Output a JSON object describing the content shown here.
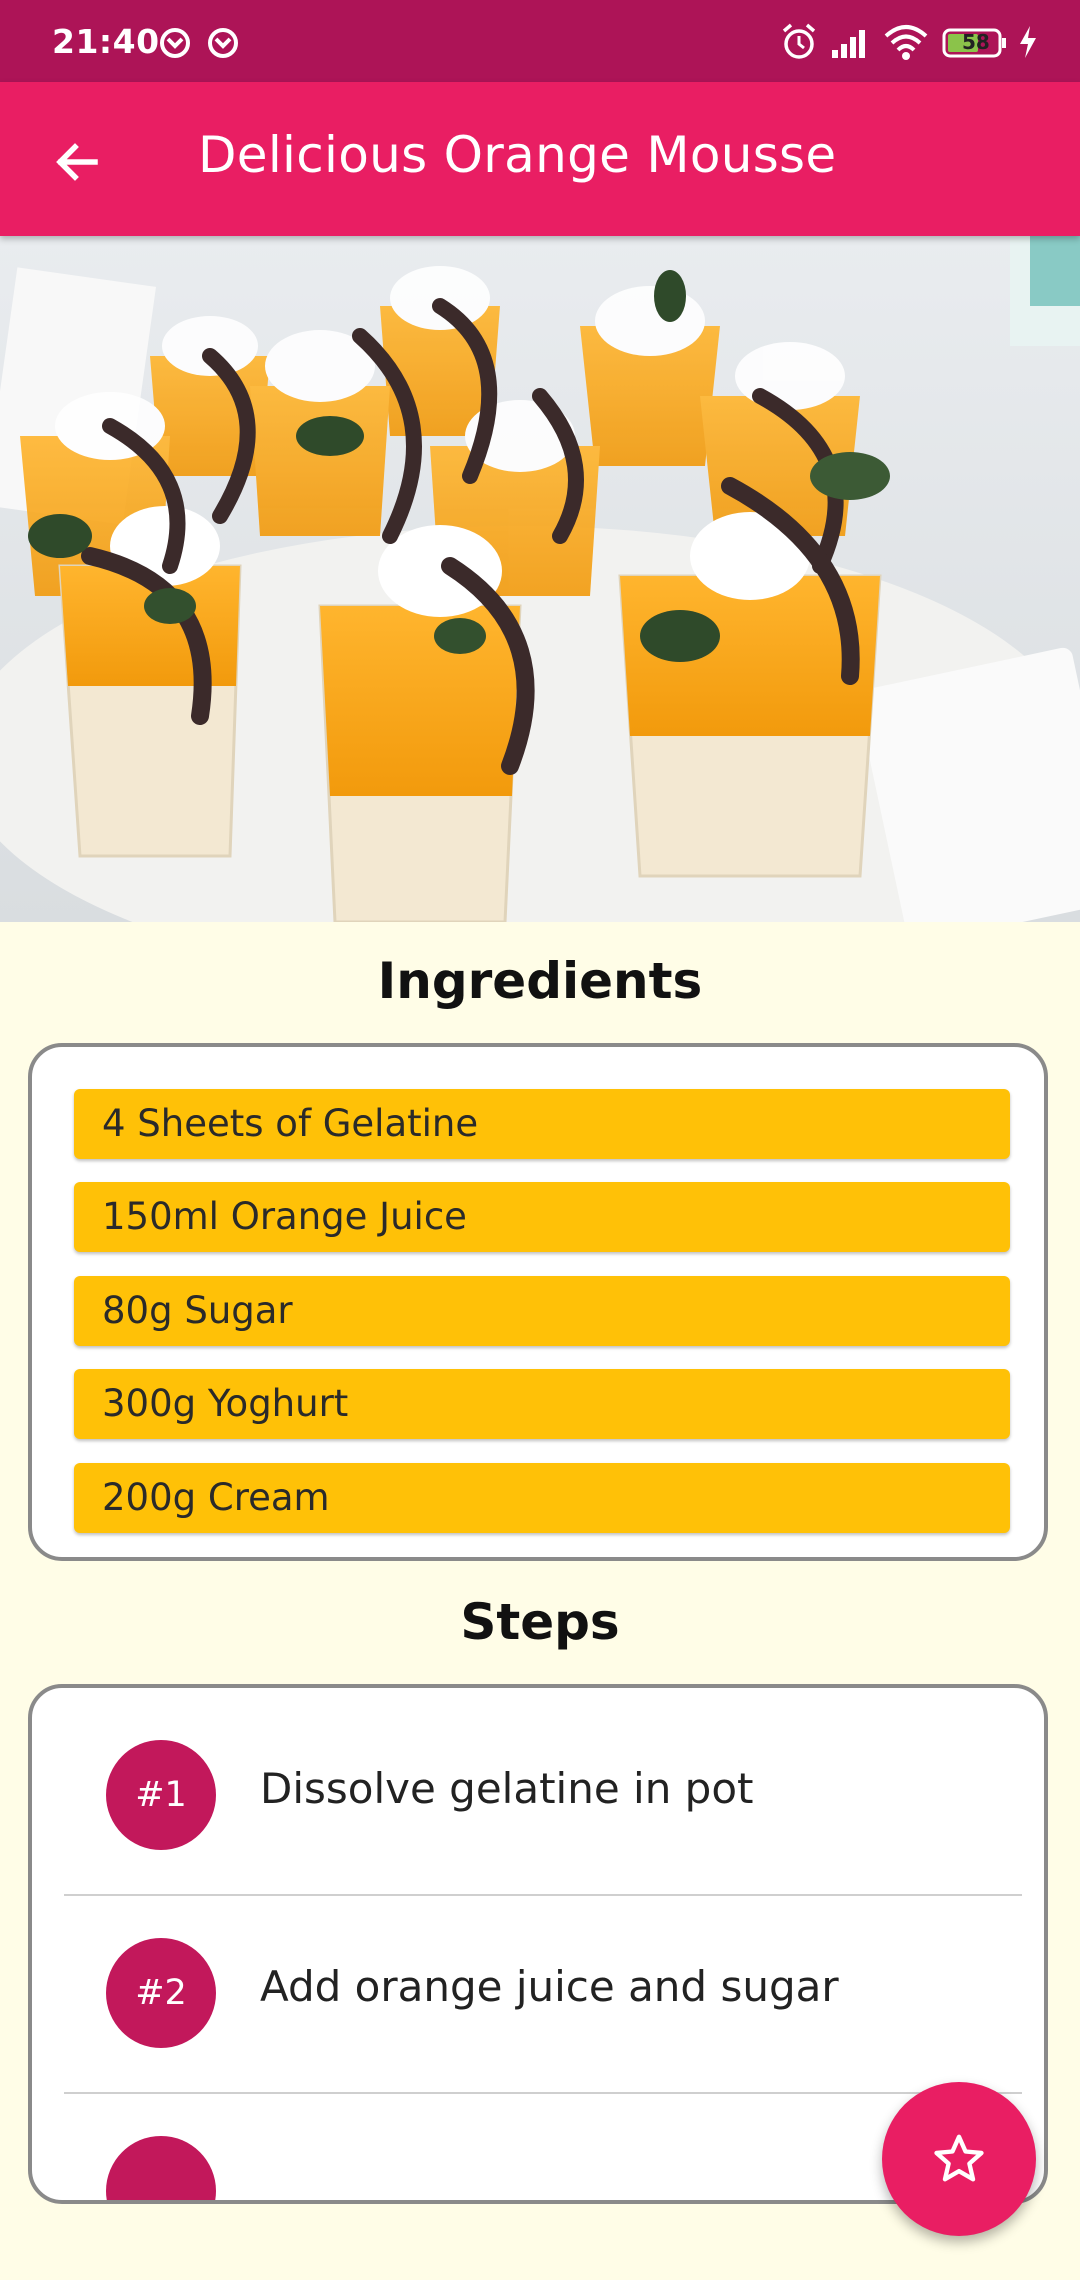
{
  "status_bar": {
    "time": "21:40",
    "battery": "58"
  },
  "app_bar": {
    "title": "Delicious Orange Mousse"
  },
  "ingredients": {
    "heading": "Ingredients",
    "items": [
      "4 Sheets of Gelatine",
      "150ml Orange Juice",
      "80g Sugar",
      "300g Yoghurt",
      "200g Cream"
    ]
  },
  "steps": {
    "heading": "Steps",
    "items": [
      {
        "number": "#1",
        "text": "Dissolve gelatine in pot"
      },
      {
        "number": "#2",
        "text": "Add orange juice and sugar"
      }
    ]
  },
  "colors": {
    "status_bar": "#ad1457",
    "app_bar": "#e91e63",
    "background": "#fffde7",
    "ingredient_chip": "#ffc107",
    "step_badge": "#c2185b",
    "fab": "#e91e63"
  },
  "icons": {
    "back": "arrow-back-icon",
    "fab": "star-outline-icon"
  }
}
